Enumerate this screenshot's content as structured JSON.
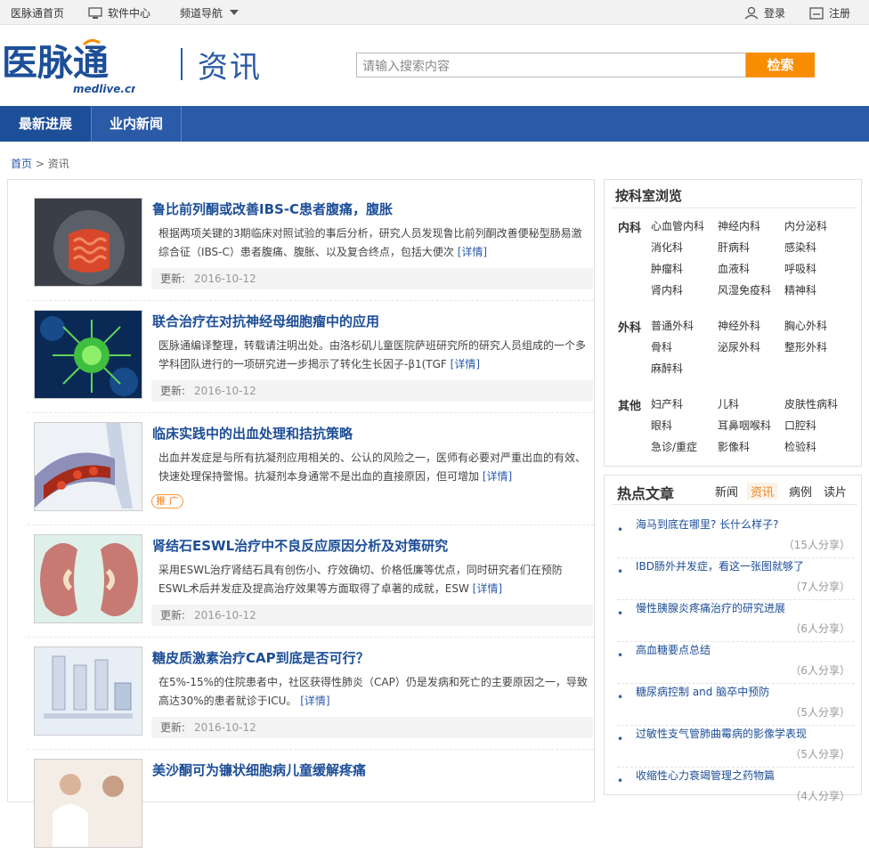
{
  "topbar": {
    "home": "医脉通首页",
    "software": "软件中心",
    "channel": "频道导航",
    "login": "登录",
    "register": "注册"
  },
  "header": {
    "logo_text": "医脉通",
    "logo_sub": "medlive.cn",
    "section": "资讯",
    "search_placeholder": "请输入搜索内容",
    "search_button": "检索"
  },
  "nav": {
    "items": [
      {
        "label": "最新进展"
      },
      {
        "label": "业内新闻"
      }
    ]
  },
  "breadcrumb": {
    "home": "首页",
    "sep": ">",
    "current": "资讯"
  },
  "articles": [
    {
      "title": "鲁比前列酮或改善IBS-C患者腹痛，腹胀",
      "desc": "根据两项关键的3期临床对照试验的事后分析，研究人员发现鲁比前列酮改善便秘型肠易激综合征（IBS-C）患者腹痛、腹胀、以及复合终点，包括大便次",
      "more": "[详情]",
      "meta_label": "更新:",
      "date": "2016-10-12",
      "thumb": "intestine"
    },
    {
      "title": "联合治疗在对抗神经母细胞瘤中的应用",
      "desc": "医脉通编译整理，转载请注明出处。由洛杉矶儿童医院萨班研究所的研究人员组成的一个多学科团队进行的一项研究进一步揭示了转化生长因子-β1(TGF",
      "more": "[详情]",
      "meta_label": "更新:",
      "date": "2016-10-12",
      "thumb": "cell"
    },
    {
      "title": "临床实践中的出血处理和拮抗策略",
      "desc": "出血并发症是与所有抗凝剂应用相关的、公认的风险之一，医师有必要对严重出血的有效、快速处理保持警惕。抗凝剂本身通常不是出血的直接原因，但可增加",
      "more": "[详情]",
      "badge": "推 广",
      "thumb": "blood"
    },
    {
      "title": "肾结石ESWL治疗中不良反应原因分析及对策研究",
      "desc": "采用ESWL治疗肾结石具有创伤小、疗效确切、价格低廉等优点，同时研究者们在预防ESWL术后并发症及提高治疗效果等方面取得了卓著的成就，ESW",
      "more": "[详情]",
      "meta_label": "更新:",
      "date": "2016-10-12",
      "thumb": "kidney"
    },
    {
      "title": "糖皮质激素治疗CAP到底是否可行？",
      "desc": "在5%-15%的住院患者中，社区获得性肺炎（CAP）仍是发病和死亡的主要原因之一，导致高达30%的患者就诊于ICU。",
      "more": "[详情]",
      "meta_label": "更新:",
      "date": "2016-10-12",
      "thumb": "vials"
    },
    {
      "title": "美沙酮可为镰状细胞病儿童缓解疼痛",
      "desc": "",
      "more": "",
      "thumb": "doctor"
    }
  ],
  "dept": {
    "title": "按科室浏览",
    "groups": [
      {
        "name": "内科",
        "items": [
          "心血管内科",
          "神经内科",
          "内分泌科",
          "消化科",
          "肝病科",
          "感染科",
          "肿瘤科",
          "血液科",
          "呼吸科",
          "肾内科",
          "风湿免疫科",
          "精神科"
        ]
      },
      {
        "name": "外科",
        "items": [
          "普通外科",
          "神经外科",
          "胸心外科",
          "骨科",
          "泌尿外科",
          "整形外科",
          "麻醉科"
        ]
      },
      {
        "name": "其他",
        "items": [
          "妇产科",
          "儿科",
          "皮肤性病科",
          "眼科",
          "耳鼻咽喉科",
          "口腔科",
          "急诊/重症",
          "影像科",
          "检验科"
        ]
      }
    ]
  },
  "hot": {
    "title": "热点文章",
    "tabs": [
      {
        "label": "新闻"
      },
      {
        "label": "资讯"
      },
      {
        "label": "病例"
      },
      {
        "label": "读片"
      }
    ],
    "items": [
      {
        "title": "海马到底在哪里? 长什么样子?",
        "share": "（15人分享）"
      },
      {
        "title": "IBD肠外并发症，看这一张图就够了",
        "share": "（7人分享）"
      },
      {
        "title": "慢性胰腺炎疼痛治疗的研究进展",
        "share": "（6人分享）"
      },
      {
        "title": "高血糖要点总结",
        "share": "（6人分享）"
      },
      {
        "title": "糖尿病控制 and 脑卒中预防",
        "share": "（5人分享）"
      },
      {
        "title": "过敏性支气管肺曲霉病的影像学表现",
        "share": "（5人分享）"
      },
      {
        "title": "收缩性心力衰竭管理之药物篇",
        "share": "（4人分享）"
      }
    ]
  },
  "colors": {
    "brand_blue": "#2a5aa8",
    "orange": "#f98d00"
  }
}
